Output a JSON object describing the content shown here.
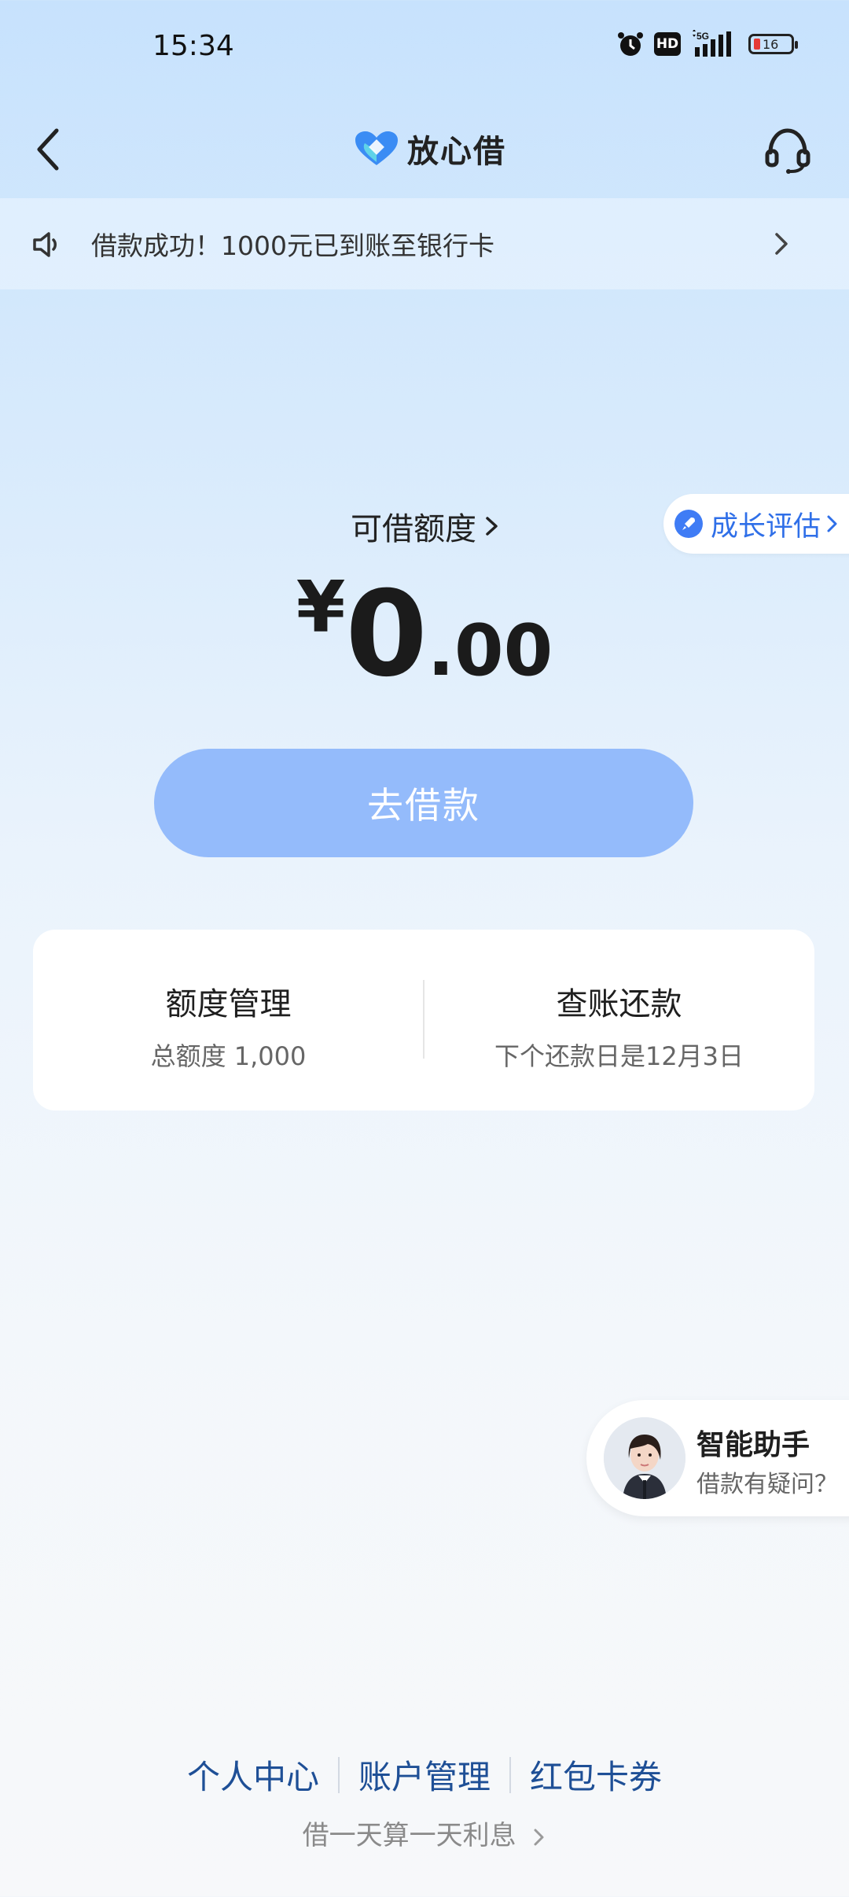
{
  "status_bar": {
    "time": "15:34",
    "hd_label": "HD",
    "network_label": "5G",
    "battery_level": "16"
  },
  "header": {
    "title": "放心借"
  },
  "notice": {
    "text": "借款成功！1000元已到账至银行卡"
  },
  "credit": {
    "label": "可借额度",
    "currency_symbol": "¥",
    "amount_int": "0",
    "amount_dec": ".00",
    "growth_label": "成长评估"
  },
  "borrow_button": {
    "label": "去借款"
  },
  "card": {
    "left": {
      "title": "额度管理",
      "subtitle": "总额度 1,000"
    },
    "right": {
      "title": "查账还款",
      "subtitle": "下个还款日是12月3日"
    }
  },
  "assistant": {
    "title": "智能助手",
    "subtitle": "借款有疑问？"
  },
  "footer": {
    "links": [
      "个人中心",
      "账户管理",
      "红包卡券"
    ],
    "note": "借一天算一天利息"
  },
  "colors": {
    "accent": "#2f6fe8",
    "button": "#94bbfb",
    "footer_link": "#1e4f96"
  }
}
